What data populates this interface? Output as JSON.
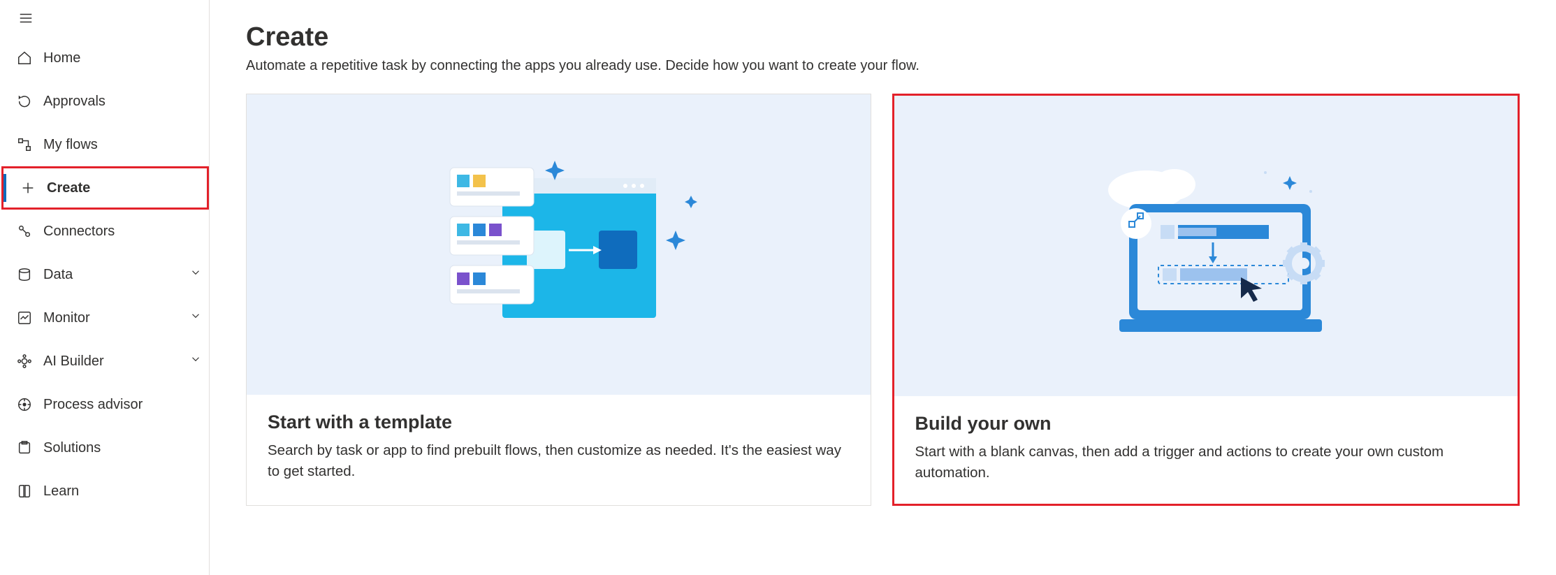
{
  "sidebar": {
    "items": [
      {
        "label": "Home"
      },
      {
        "label": "Approvals"
      },
      {
        "label": "My flows"
      },
      {
        "label": "Create"
      },
      {
        "label": "Connectors"
      },
      {
        "label": "Data"
      },
      {
        "label": "Monitor"
      },
      {
        "label": "AI Builder"
      },
      {
        "label": "Process advisor"
      },
      {
        "label": "Solutions"
      },
      {
        "label": "Learn"
      }
    ]
  },
  "page": {
    "title": "Create",
    "subtitle": "Automate a repetitive task by connecting the apps you already use. Decide how you want to create your flow."
  },
  "cards": [
    {
      "title": "Start with a template",
      "desc": "Search by task or app to find prebuilt flows, then customize as needed. It's the easiest way to get started."
    },
    {
      "title": "Build your own",
      "desc": "Start with a blank canvas, then add a trigger and actions to create your own custom automation."
    }
  ]
}
